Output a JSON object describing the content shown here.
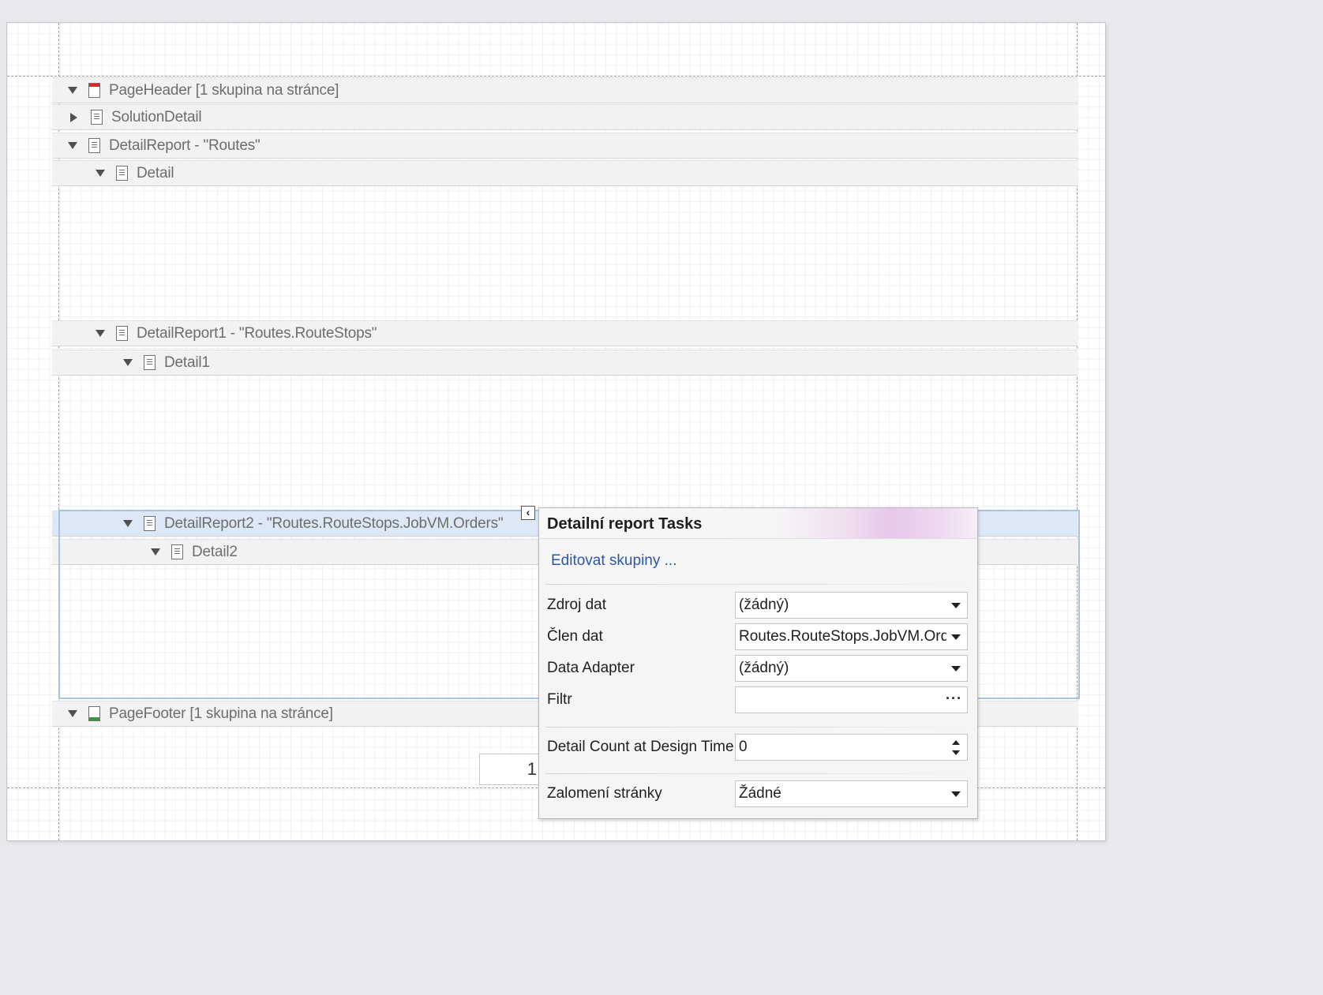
{
  "bands": [
    {
      "id": "pageheader",
      "label": "PageHeader [1 skupina na stránce]",
      "expanded": true,
      "icon": "page-header-band-icon"
    },
    {
      "id": "solutiondetail",
      "label": "SolutionDetail",
      "expanded": false,
      "icon": "detail-band-icon"
    },
    {
      "id": "detailreport",
      "label": "DetailReport - \"Routes\"",
      "expanded": true,
      "icon": "detail-band-icon"
    },
    {
      "id": "detail",
      "label": "Detail",
      "expanded": true,
      "icon": "detail-band-icon"
    },
    {
      "id": "detailreport1",
      "label": "DetailReport1 - \"Routes.RouteStops\"",
      "expanded": true,
      "icon": "detail-band-icon"
    },
    {
      "id": "detail1",
      "label": "Detail1",
      "expanded": true,
      "icon": "detail-band-icon"
    },
    {
      "id": "detailreport2",
      "label": "DetailReport2 - \"Routes.RouteStops.JobVM.Orders\"",
      "expanded": true,
      "icon": "detail-band-icon",
      "selected": true
    },
    {
      "id": "detail2",
      "label": "Detail2",
      "expanded": true,
      "icon": "detail-band-icon"
    },
    {
      "id": "pagefooter",
      "label": "PageFooter [1 skupina na stránce]",
      "expanded": true,
      "icon": "page-footer-band-icon"
    }
  ],
  "pager": {
    "value": "1"
  },
  "tasks": {
    "title": "Detailní report Tasks",
    "link": "Editovat skupiny ...",
    "rows": {
      "data_source": {
        "label": "Zdroj dat",
        "value": "(žádný)"
      },
      "data_member": {
        "label": "Člen dat",
        "value": "Routes.RouteStops.JobVM.Orders"
      },
      "data_adapter": {
        "label": "Data Adapter",
        "value": "(žádný)"
      },
      "filter": {
        "label": "Filtr",
        "value": ""
      },
      "detail_count": {
        "label": "Detail Count at Design Time",
        "value": "0"
      },
      "page_break": {
        "label": "Zalomení stránky",
        "value": "Žádné"
      }
    }
  },
  "colors": {
    "selected_band": "#dde8f6",
    "link": "#2b57a8",
    "page_header_icon": "#d8282a",
    "page_footer_icon": "#3a9a3a"
  }
}
